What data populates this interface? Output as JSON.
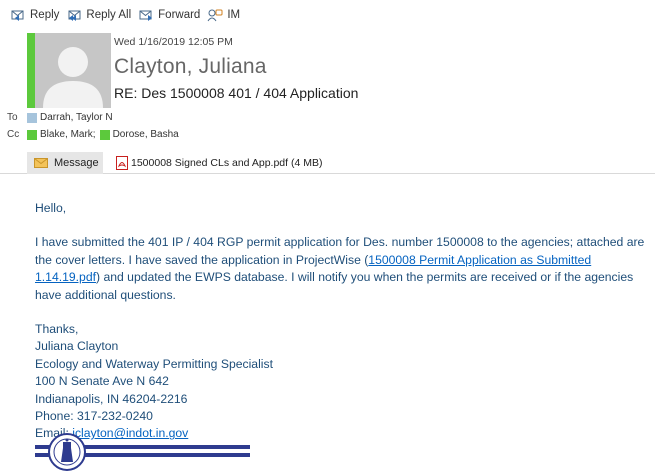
{
  "toolbar": {
    "reply": "Reply",
    "reply_all": "Reply All",
    "forward": "Forward",
    "im": "IM"
  },
  "header": {
    "date": "Wed 1/16/2019 12:05 PM",
    "sender": "Clayton, Juliana",
    "subject": "RE: Des 1500008 401 / 404 Application",
    "to_label": "To",
    "to": [
      "Darrah, Taylor N"
    ],
    "cc_label": "Cc",
    "cc": [
      "Blake, Mark;",
      "Dorose, Basha"
    ]
  },
  "colors": {
    "presence": "#5cc93c",
    "to_square": "#a6c4dc",
    "cc_square": "#5cc93c",
    "link": "#0563c1",
    "body_text": "#1f4e79"
  },
  "attachments": {
    "message_tab": "Message",
    "file": "1500008 Signed CLs and App.pdf (4 MB)"
  },
  "body": {
    "greeting": "Hello,",
    "p1_a": "I have submitted the 401 IP / 404 RGP permit application for Des. number 1500008 to the agencies; attached are the cover letters.  I have saved the application in ProjectWise (",
    "p1_link": "1500008 Permit Application as Submitted 1.14.19.pdf",
    "p1_b": ") and updated the EWPS database.  I will notify you when the permits are received or if the agencies have additional questions.",
    "closing": "Thanks,",
    "sig_name": "Juliana Clayton",
    "sig_title": "Ecology and Waterway Permitting Specialist",
    "sig_addr1": "100 N Senate Ave N 642",
    "sig_addr2": "Indianapolis, IN 46204-2216",
    "sig_phone": "Phone: 317-232-0240",
    "sig_email_label": "Email: ",
    "sig_email": "jclayton@indot.in.gov"
  }
}
